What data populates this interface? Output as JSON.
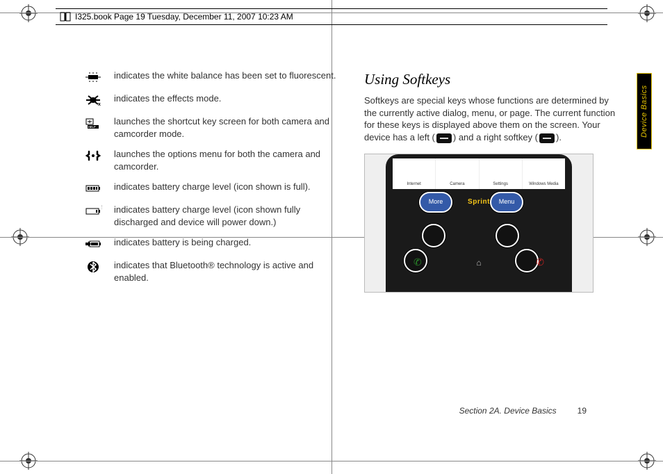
{
  "header": {
    "text": "I325.book  Page 19  Tuesday, December 11, 2007  10:23 AM"
  },
  "iconList": [
    {
      "icon": "white-balance-fluorescent-icon",
      "text": "indicates the white balance has been set to fluorescent."
    },
    {
      "icon": "effects-mode-icon",
      "text": "indicates the effects mode."
    },
    {
      "icon": "shortcut-help-icon",
      "text": "launches the shortcut key screen for both camera and camcorder mode."
    },
    {
      "icon": "options-menu-icon",
      "text": "launches the options menu for both the camera and camcorder."
    },
    {
      "icon": "battery-full-icon",
      "text": "indicates battery charge level (icon shown is full)."
    },
    {
      "icon": "battery-empty-icon",
      "text": "indicates battery charge level (icon shown fully discharged and device will power down.)"
    },
    {
      "icon": "battery-charging-icon",
      "text": "indicates battery is being charged."
    },
    {
      "icon": "bluetooth-active-icon",
      "text": "indicates that Bluetooth® technology is active and enabled."
    }
  ],
  "rightCol": {
    "heading": "Using Softkeys",
    "para1a": "Softkeys are special keys whose functions are determined by the currently active dialog, menu, or page. The current function for these keys is displayed above them on the screen. Your device has a left (",
    "para1b": ") and a right softkey (",
    "para1c": ")."
  },
  "device": {
    "apps": [
      "Internet",
      "Camera",
      "Settings",
      "Windows Media"
    ],
    "leftBubble": "More",
    "rightBubble": "Menu",
    "brand": "Sprint"
  },
  "sideTab": "Device Basics",
  "footer": {
    "section": "Section 2A. Device Basics",
    "page": "19"
  }
}
